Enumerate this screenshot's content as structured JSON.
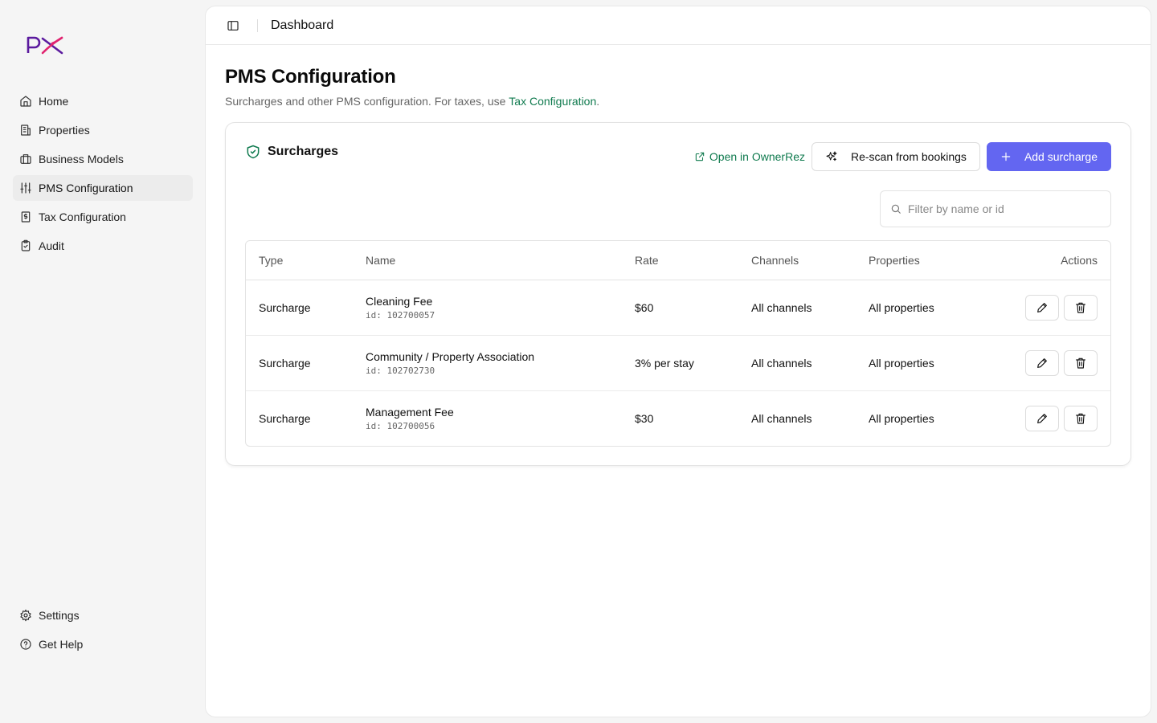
{
  "brand": {
    "logo_text": "PX",
    "color_primary": "#5b1a9e",
    "color_accent": "#e0236f"
  },
  "sidebar": {
    "items": [
      {
        "label": "Home",
        "icon": "home-icon",
        "active": false
      },
      {
        "label": "Properties",
        "icon": "building-icon",
        "active": false
      },
      {
        "label": "Business Models",
        "icon": "briefcase-icon",
        "active": false
      },
      {
        "label": "PMS Configuration",
        "icon": "sliders-icon",
        "active": true
      },
      {
        "label": "Tax Configuration",
        "icon": "receipt-icon",
        "active": false
      },
      {
        "label": "Audit",
        "icon": "clipboard-check-icon",
        "active": false
      }
    ],
    "bottom_items": [
      {
        "label": "Settings",
        "icon": "gear-icon"
      },
      {
        "label": "Get Help",
        "icon": "help-circle-icon"
      }
    ]
  },
  "header": {
    "breadcrumb": "Dashboard"
  },
  "page": {
    "title": "PMS Configuration",
    "subtitle_prefix": "Surcharges and other PMS configuration. For taxes, use ",
    "subtitle_link": "Tax Configuration",
    "subtitle_suffix": "."
  },
  "surcharges": {
    "title": "Surcharges",
    "open_link": "Open in OwnerRez",
    "rescan_label": "Re-scan from bookings",
    "add_label": "Add surcharge",
    "filter_placeholder": "Filter by name or id",
    "columns": [
      "Type",
      "Name",
      "Rate",
      "Channels",
      "Properties",
      "Actions"
    ],
    "rows": [
      {
        "type": "Surcharge",
        "name": "Cleaning Fee",
        "id": "id: 102700057",
        "rate": "$60",
        "channels": "All channels",
        "properties": "All properties"
      },
      {
        "type": "Surcharge",
        "name": "Community / Property Association",
        "id": "id: 102702730",
        "rate": "3% per stay",
        "channels": "All channels",
        "properties": "All properties"
      },
      {
        "type": "Surcharge",
        "name": "Management Fee",
        "id": "id: 102700056",
        "rate": "$30",
        "channels": "All channels",
        "properties": "All properties"
      }
    ]
  },
  "colors": {
    "accent_green": "#0f7a4e",
    "primary_button": "#6366f1"
  }
}
